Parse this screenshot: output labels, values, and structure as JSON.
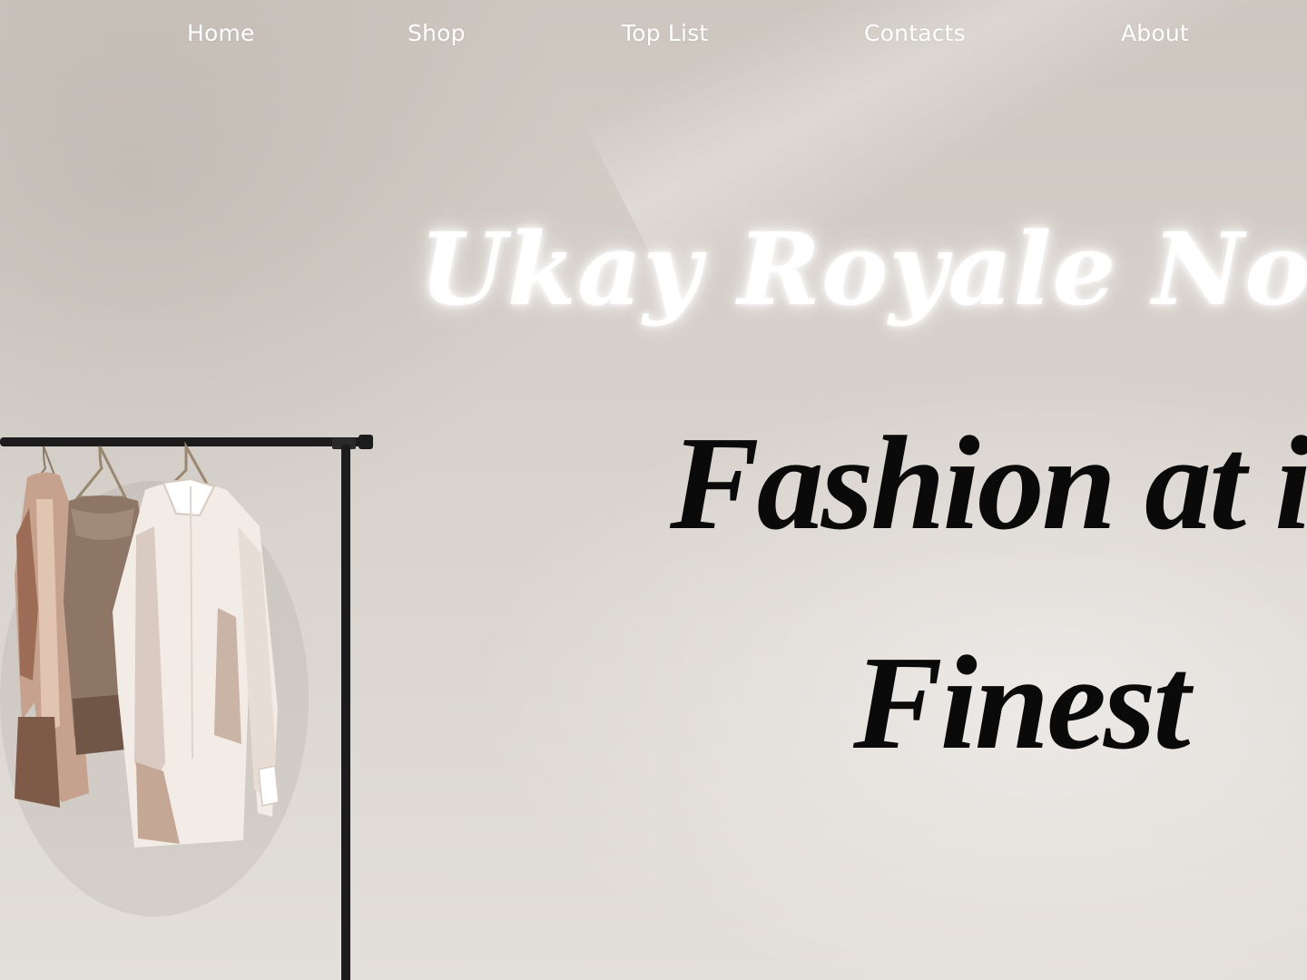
{
  "nav": {
    "items": [
      {
        "label": "Home"
      },
      {
        "label": "Shop"
      },
      {
        "label": "Top List"
      },
      {
        "label": "Contacts"
      },
      {
        "label": "About"
      }
    ]
  },
  "hero": {
    "brand": "Ukay Royale Nova",
    "tagline_line1": "Fashion at it's",
    "tagline_line2": "Finest"
  },
  "colors": {
    "nav_text": "#ffffff",
    "brand_text": "#ffffff",
    "tagline_text": "#0a0a0a",
    "background": "#d9d3cd"
  }
}
